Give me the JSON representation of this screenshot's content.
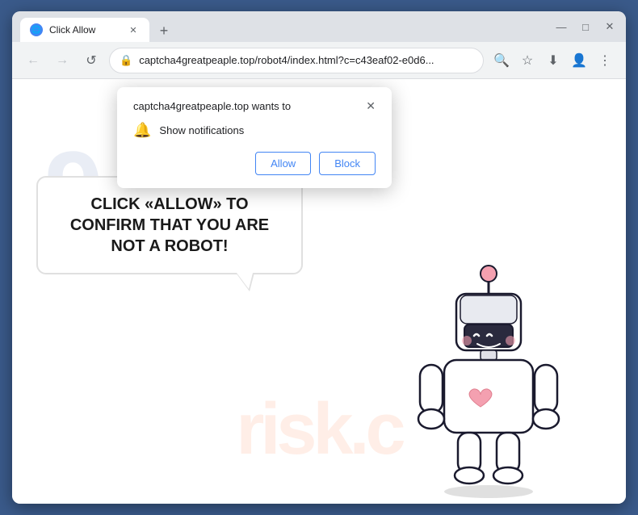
{
  "browser": {
    "tab": {
      "title": "Click Allow",
      "favicon": "🌐"
    },
    "url": "captcha4greatpeaple.top/robot4/index.html?c=c43eaf02-e0d6...",
    "url_domain": "captcha4greatpeaple.top",
    "url_path": "/robot4/index.html?c=c43eaf02-e0d6...",
    "nav": {
      "back": "←",
      "forward": "→",
      "reload": "↺"
    }
  },
  "dialog": {
    "title": "captcha4greatpeaple.top wants to",
    "close_label": "✕",
    "permission_text": "Show notifications",
    "allow_label": "Allow",
    "block_label": "Block"
  },
  "page": {
    "bubble_text": "CLICK «ALLOW» TO CONFIRM THAT YOU ARE NOT A ROBOT!",
    "watermark": "risk.c"
  },
  "icons": {
    "search": "🔍",
    "star": "☆",
    "account": "👤",
    "menu": "⋮",
    "download": "⬇",
    "lock": "🔒",
    "bell": "🔔",
    "minimize": "—",
    "maximize": "□",
    "close": "✕",
    "newtab": "+"
  }
}
